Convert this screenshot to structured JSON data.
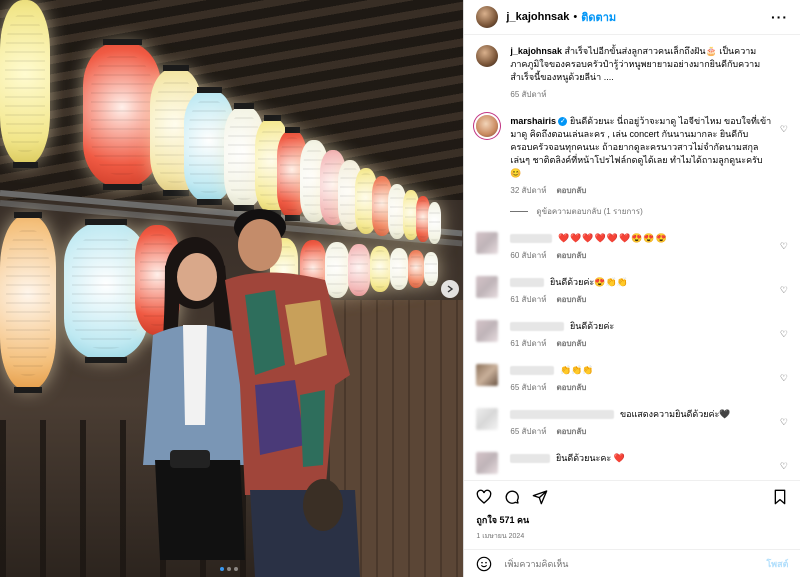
{
  "header": {
    "username": "j_kajohnsak",
    "separator": "•",
    "follow_label": "ติดตาม",
    "more_label": "···"
  },
  "caption": {
    "username": "j_kajohnsak",
    "text": "สำเร็จไปอีกขั้นส่งลูกสาวคนเล็กถึงฝัน🎂 เป็นความภาคภูมิใจของครอบครัวป๋ารู้ว่าหนูพยายามอย่างมากยินดีกับความสำเร็จนี้ของหนูด้วยลีน่า ....",
    "time": "65 สัปดาห์"
  },
  "comments": [
    {
      "username": "marshairis",
      "verified": true,
      "text": " ยินดีด้วยนะ นี่ถอยู่ว้าจะมาดู ไอจีข่าไหม ขอบใจที่เข้ามาดู คิดถึงตอนเล่นละคร , เล่น concert กันนานมากละ ยินดีกับครอบครัวจอนทุกคนนะ ถ้าอยากดูละครนาวสาวไม่จำกัดนามสกุลเล่นๆ ชาติตลิงค์ที่หน้าโปรไฟล์กดดูได้เลย ทำไมได้ถามลูกดูนะครับ😊",
      "time": "32 สัปดาห์",
      "reply": "ตอบกลับ",
      "view_replies": "ดูข้อความตอบกลับ (1 รายการ)"
    },
    {
      "text": "❤️❤️❤️❤️❤️❤️😍😍😍",
      "time": "60 สัปดาห์",
      "reply": "ตอบกลับ"
    },
    {
      "text": "ยินดีด้วยค่ะ😍👏👏",
      "time": "61 สัปดาห์",
      "reply": "ตอบกลับ"
    },
    {
      "text": "ยินดีด้วยค่ะ",
      "time": "61 สัปดาห์",
      "reply": "ตอบกลับ"
    },
    {
      "text": "👏👏👏",
      "time": "65 สัปดาห์",
      "reply": "ตอบกลับ"
    },
    {
      "text": "ขอแสดงความยินดีด้วยค่ะ🖤",
      "time": "65 สัปดาห์",
      "reply": "ตอบกลับ"
    },
    {
      "text": "ยินดีด้วยนะคะ ❤️",
      "time": "",
      "reply": ""
    }
  ],
  "actions": {
    "likes": "ถูกใจ 571 คน",
    "date": "1 เมษายน 2024"
  },
  "add_comment": {
    "placeholder": "เพิ่มความคิดเห็น",
    "post_label": "โพสต์"
  },
  "icons": {
    "like": "heart-icon",
    "comment": "comment-icon",
    "share": "send-icon",
    "save": "bookmark-icon",
    "emoji": "emoji-icon",
    "next": "chevron-right-icon"
  },
  "colors": {
    "accent": "#0095f6",
    "heart": "#ed4956",
    "muted": "#737373"
  }
}
